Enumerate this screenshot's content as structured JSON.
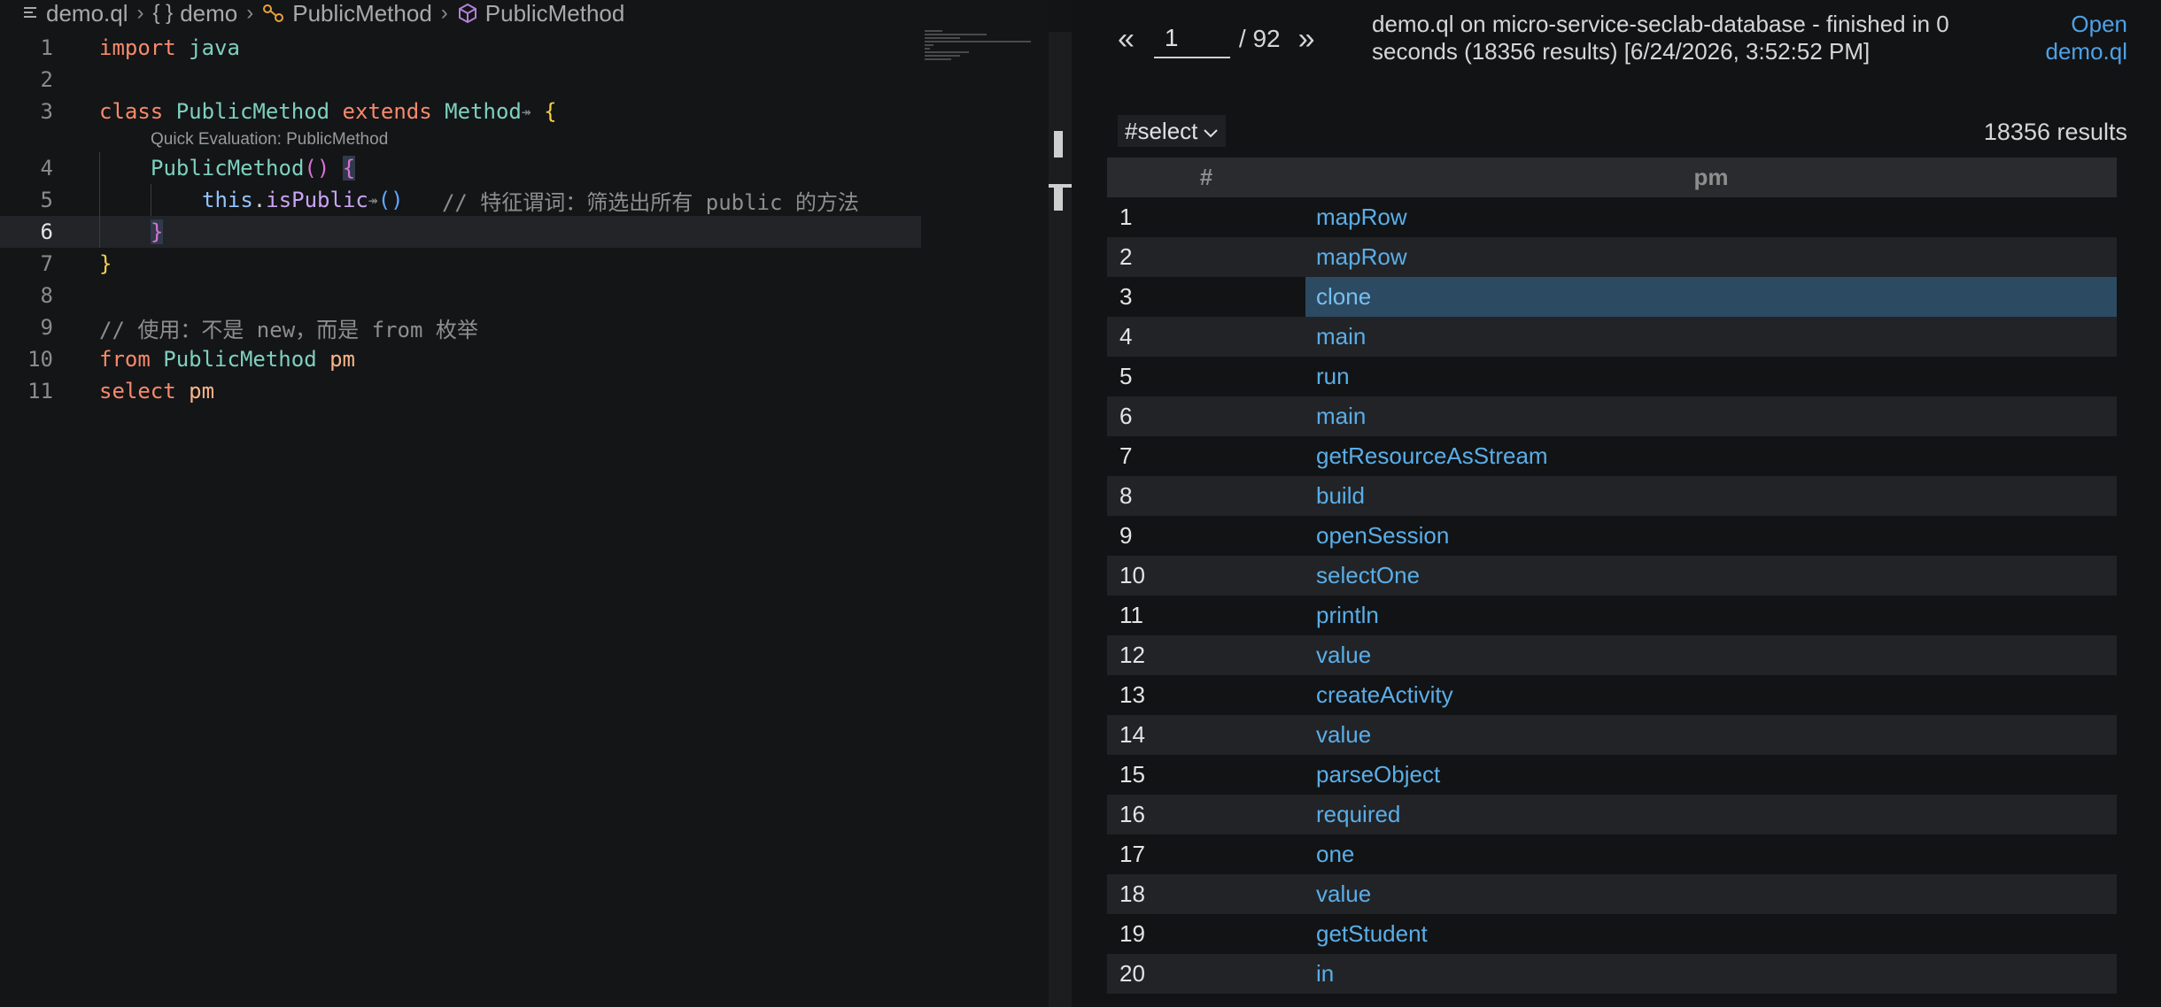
{
  "breadcrumb": {
    "file": "demo.ql",
    "module": "demo",
    "class": "PublicMethod",
    "symbol": "PublicMethod"
  },
  "code": {
    "line_numbers": [
      "1",
      "2",
      "3",
      "4",
      "5",
      "6",
      "7",
      "8",
      "9",
      "10",
      "11"
    ],
    "l1": {
      "kw": "import",
      "mod": "java"
    },
    "l3": {
      "kw": "class",
      "name": "PublicMethod",
      "kw2": "extends",
      "base": "Method",
      "brace": "{"
    },
    "lens": "Quick Evaluation: PublicMethod",
    "l4": {
      "name": "PublicMethod",
      "parens": "()",
      "brace": "{"
    },
    "l5": {
      "this": "this",
      "dot": ".",
      "call": "isPublic",
      "parens": "()",
      "comment": "// 特征谓词：筛选出所有 public 的方法"
    },
    "l6": {
      "brace": "}"
    },
    "l7": {
      "brace": "}"
    },
    "l9": {
      "comment": "// 使用：不是 new，而是 from 枚举"
    },
    "l10": {
      "kw": "from",
      "type": "PublicMethod",
      "var": "pm"
    },
    "l11": {
      "kw": "select",
      "var": "pm"
    }
  },
  "results": {
    "page_current": "1",
    "page_total": "/ 92",
    "prev": "«",
    "next": "»",
    "status": "demo.ql on micro-service-seclab-database - finished in 0 seconds (18356 results) [6/24/2026, 3:52:52 PM]",
    "open_link": "Open demo.ql",
    "result_set": "#select",
    "count": "18356 results",
    "headers": [
      "#",
      "pm"
    ],
    "rows": [
      {
        "n": "1",
        "pm": "mapRow"
      },
      {
        "n": "2",
        "pm": "mapRow"
      },
      {
        "n": "3",
        "pm": "clone"
      },
      {
        "n": "4",
        "pm": "main"
      },
      {
        "n": "5",
        "pm": "run"
      },
      {
        "n": "6",
        "pm": "main"
      },
      {
        "n": "7",
        "pm": "getResourceAsStream"
      },
      {
        "n": "8",
        "pm": "build"
      },
      {
        "n": "9",
        "pm": "openSession"
      },
      {
        "n": "10",
        "pm": "selectOne"
      },
      {
        "n": "11",
        "pm": "println"
      },
      {
        "n": "12",
        "pm": "value"
      },
      {
        "n": "13",
        "pm": "createActivity"
      },
      {
        "n": "14",
        "pm": "value"
      },
      {
        "n": "15",
        "pm": "parseObject"
      },
      {
        "n": "16",
        "pm": "required"
      },
      {
        "n": "17",
        "pm": "one"
      },
      {
        "n": "18",
        "pm": "value"
      },
      {
        "n": "19",
        "pm": "getStudent"
      },
      {
        "n": "20",
        "pm": "in"
      }
    ],
    "selected_row": 3
  }
}
